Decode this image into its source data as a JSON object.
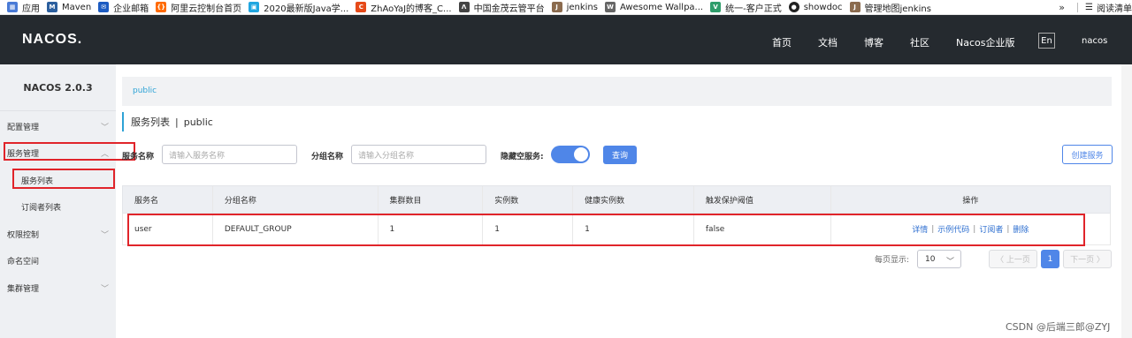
{
  "bookmarks": {
    "items": [
      {
        "label": "应用",
        "icon": "apps-grid-icon",
        "color": "#4a7bd6"
      },
      {
        "label": "Maven",
        "icon": "mvn-icon",
        "color": "#2c5f9e"
      },
      {
        "label": "企业邮箱",
        "icon": "mail-icon",
        "color": "#1d5cc2"
      },
      {
        "label": "阿里云控制台首页",
        "icon": "aliyun-icon",
        "color": "#ff6a00"
      },
      {
        "label": "2020最新版Java学...",
        "icon": "bilibili-icon",
        "color": "#21a6e0"
      },
      {
        "label": "ZhAoYaJ的博客_C...",
        "icon": "csdn-icon",
        "color": "#e64a19"
      },
      {
        "label": "中国金茂云管平台",
        "icon": "logo-a-icon",
        "color": "#444444"
      },
      {
        "label": "jenkins",
        "icon": "jenkins-icon",
        "color": "#8b6b4e"
      },
      {
        "label": "Awesome Wallpa...",
        "icon": "wallpaper-icon",
        "color": "#666666"
      },
      {
        "label": "统一-客户正式",
        "icon": "vue-icon",
        "color": "#2f9d6b"
      },
      {
        "label": "showdoc",
        "icon": "showdoc-icon",
        "color": "#222222"
      },
      {
        "label": "管理地图jenkins",
        "icon": "jenkins-icon",
        "color": "#8b6b4e"
      }
    ],
    "more": "»",
    "reading_list": "阅读清单"
  },
  "nav": {
    "logo": "NACOS.",
    "links": [
      "首页",
      "文档",
      "博客",
      "社区",
      "Nacos企业版"
    ],
    "lang": "En",
    "user": "nacos"
  },
  "sidebar": {
    "version": "NACOS 2.0.3",
    "items": [
      {
        "label": "配置管理",
        "chevron": "﹀"
      },
      {
        "label": "服务管理",
        "chevron": "︿"
      },
      {
        "label": "服务列表",
        "chevron": ""
      },
      {
        "label": "订阅者列表",
        "chevron": ""
      },
      {
        "label": "权限控制",
        "chevron": "﹀"
      },
      {
        "label": "命名空间",
        "chevron": ""
      },
      {
        "label": "集群管理",
        "chevron": "﹀"
      }
    ]
  },
  "main": {
    "breadcrumb": "public",
    "title": "服务列表",
    "title_sep": "|",
    "namespace": "public",
    "filters": {
      "service_label": "服务名称",
      "service_placeholder": "请输入服务名称",
      "group_label": "分组名称",
      "group_placeholder": "请输入分组名称",
      "hide_empty_label": "隐藏空服务:",
      "hide_empty_on": true,
      "query_button": "查询",
      "create_button": "创建服务"
    },
    "table": {
      "headers": [
        "服务名",
        "分组名称",
        "集群数目",
        "实例数",
        "健康实例数",
        "触发保护阈值",
        "操作"
      ],
      "rows": [
        {
          "service": "user",
          "group": "DEFAULT_GROUP",
          "clusters": "1",
          "instances": "1",
          "healthy": "1",
          "threshold": "false",
          "ops": [
            "详情",
            "示例代码",
            "订阅者",
            "删除"
          ]
        }
      ]
    },
    "pagination": {
      "per_page_label": "每页显示:",
      "per_page": "10",
      "prev": "〈 上一页",
      "current": "1",
      "next": "下一页 〉"
    }
  },
  "watermark": "CSDN @后端三郎@ZYJ",
  "colors": {
    "accent": "#4f86e8",
    "highlight": "#e0242a",
    "navbar": "#252a2f",
    "sidebar": "#eef0f3",
    "link": "#2ea3d6"
  }
}
